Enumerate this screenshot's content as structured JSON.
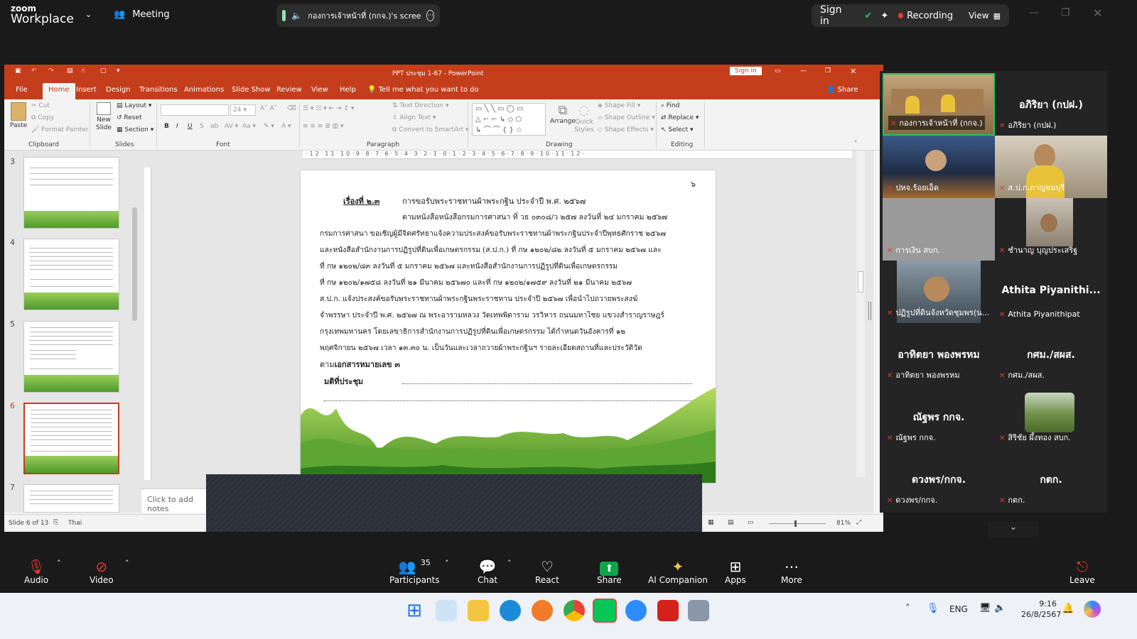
{
  "zoom": {
    "brand_top": "zoom",
    "brand_bottom": "Workplace",
    "meeting_label": "Meeting",
    "share_title": "กองการเจ้าหน้าที่ (กกจ.)'s scree",
    "sign_in": "Sign in",
    "recording": "Recording",
    "view": "View"
  },
  "ppt": {
    "title": "PPT ประชุม 1-67  -  PowerPoint",
    "sign_in": "Sign in",
    "tabs": [
      "File",
      "Home",
      "Insert",
      "Design",
      "Transitions",
      "Animations",
      "Slide Show",
      "Review",
      "View",
      "Help"
    ],
    "tell_me": "Tell me what you want to do",
    "share": "Share",
    "ribbon": {
      "paste": "Paste",
      "cut": "Cut",
      "copy": "Copy",
      "format_painter": "Format Painter",
      "new_slide": "New Slide",
      "layout": "Layout",
      "reset": "Reset",
      "section": "Section",
      "font_size": "24",
      "text_direction": "Text Direction",
      "align_text": "Align Text",
      "convert_smartart": "Convert to SmartArt",
      "arrange": "Arrange",
      "quick_styles": "Quick Styles",
      "shape_fill": "Shape Fill",
      "shape_outline": "Shape Outline",
      "shape_effects": "Shape Effects",
      "find": "Find",
      "replace": "Replace",
      "select": "Select",
      "groups": [
        "Clipboard",
        "Slides",
        "Font",
        "Paragraph",
        "Drawing",
        "Editing"
      ]
    },
    "thumbnails": [
      "3",
      "4",
      "5",
      "6",
      "7"
    ],
    "slide": {
      "page_number": "๖",
      "heading_label": "เรื่องที่ ๒.๓",
      "heading_text": "การขอรับพระราชทานผ้าพระกฐิน ประจำปี พ.ศ. ๒๕๖๗",
      "lines": [
        "ตามหนังสือหนังสือกรมการศาสนา ที่ วธ ๐๓๐๘/ว ๒๕๗ ลงวันที่ ๒๔ มกราคม ๒๕๖๗",
        "กรมการศาสนา ขอเชิญผู้มีจิตศรัทธาแจ้งความประสงค์ขอรับพระราชทานผ้าพระกฐินประจำปีพุทธศักราช ๒๕๖๗",
        "และหนังสือสำนักงานการปฏิรูปที่ดินเพื่อเกษตรกรรม (ส.ป.ก.) ที่ กษ ๑๒๐๒/๘๒ ลงวันที่ ๕ มกราคม ๒๕๖๗ และ",
        "ที่ กษ ๑๒๐๒/๘๓ ลงวันที่ ๕ มกราคม ๒๕๖๗ และหนังสือสำนักงานการปฏิรูปที่ดินเพื่อเกษตรกรรม",
        "ที่ กษ ๑๒๐๒/๑๗๕๘ ลงวันที่ ๒๑ มีนาคม ๒๕๖๗๐ และที่ กษ ๑๒๐๒/๑๗๕๙ ลงวันที่ ๒๑ มีนาคม ๒๕๖๗",
        "ส.ป.ก. แจ้งประสงค์ขอรับพระราชทานผ้าพระกฐินพระราชทาน ประจำปี ๒๕๖๗ เพื่อนำไปถวายพระสงฆ์",
        "จำพรรษา ประจำปี พ.ศ. ๒๕๖๗ ณ พระอารามหลวง วัดเทพพิดาราม วรวิหาร ถนนมหาไชย แขวงสำราญราษฎร์",
        "กรุงเทพมหานคร โดยเลขาธิการสำนักงานการปฏิรูปที่ดินเพื่อเกษตรกรรม ได้กำหนดวันอังคารที่ ๑๒",
        "พฤศจิกายน ๒๕๖๗ เวลา ๑๓.๓๐ น. เป็นวันและเวลาถวายผ้าพระกฐินฯ รายละเอียดสถานที่และประวัติวัด"
      ],
      "last_prefix": "ตาม",
      "last_bold": "เอกสารหมายเลข ๓",
      "resolution": "มติที่ประชุม"
    },
    "notes_placeholder": "Click to add notes",
    "status": "Slide 6 of 13",
    "language": "Thai",
    "zoom_level": "81%"
  },
  "participants": [
    {
      "name": "กองการเจ้าหน้าที่ (กกจ.)",
      "video": true,
      "active": true
    },
    {
      "name": "อภิริยา (กปฝ.)",
      "big": "อภิริยา (กปฝ.)"
    },
    {
      "name": "ปหจ.ร้อยเอ็ด",
      "video": true
    },
    {
      "name": "ส.ป.ก.กาญจนบุรี",
      "video": true
    },
    {
      "name": "การเงิน สบก.",
      "video": true
    },
    {
      "name": "ชำนาญ บุญประเสริฐ",
      "video": true
    },
    {
      "name": "ปฏิรูปที่ดินจังหวัดชุมพร(น...",
      "video": true
    },
    {
      "name": "Athita Piyanithipat",
      "big": "Athita  Piyanithi..."
    },
    {
      "name": "อาทิตยา พองพรหม",
      "big": "อาทิตยา พองพรหม"
    },
    {
      "name": "กศม./สผส.",
      "big": "กศม./สผส."
    },
    {
      "name": "ณัฐพร กกจ.",
      "big": "ณัฐพร กกจ."
    },
    {
      "name": "สิริชัย ผึ้งทอง  สบก.",
      "video": true
    },
    {
      "name": "ดวงพร/กกจ.",
      "big": "ดวงพร/กกจ."
    },
    {
      "name": "กตก.",
      "big": "กตก."
    }
  ],
  "toolbar": {
    "audio": "Audio",
    "video": "Video",
    "participants": "Participants",
    "participants_count": "35",
    "chat": "Chat",
    "react": "React",
    "share": "Share",
    "ai_companion": "AI Companion",
    "apps": "Apps",
    "more": "More",
    "leave": "Leave"
  },
  "taskbar": {
    "language": "ENG",
    "time": "9:16",
    "date": "26/8/2567"
  },
  "colors": {
    "ppt_accent": "#c43e1c",
    "zoom_share": "#0ea54b",
    "recording": "#e53935"
  }
}
